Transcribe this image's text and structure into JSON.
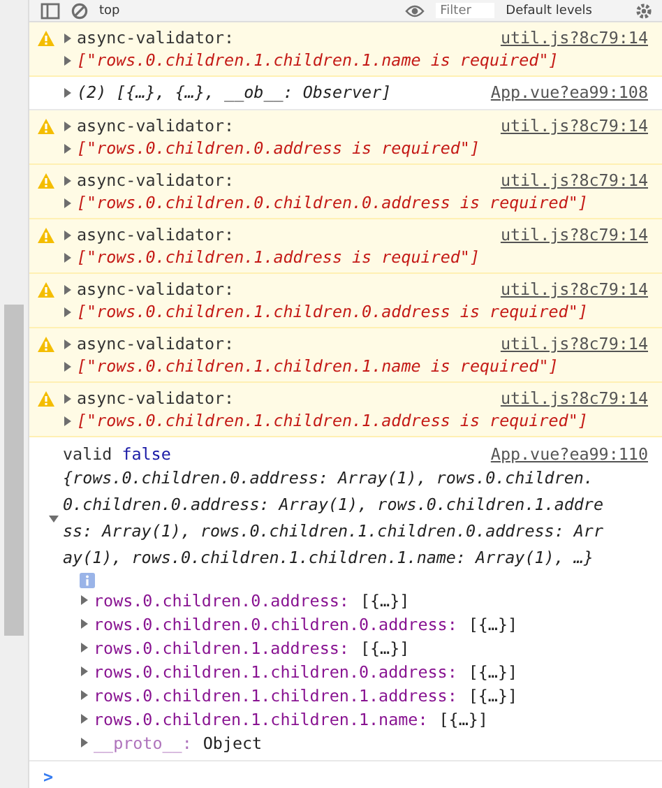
{
  "toolbar": {
    "context": "top",
    "filter_placeholder": "Filter",
    "levels": "Default levels"
  },
  "messages": [
    {
      "kind": "warning",
      "label": "async-validator:",
      "value": "[\"rows.0.children.1.children.1.name is required\"]",
      "source": "util.js?8c79:14"
    },
    {
      "kind": "log",
      "value": "(2) [{…}, {…}, __ob__: Observer]",
      "source": "App.vue?ea99:108"
    },
    {
      "kind": "warning",
      "label": "async-validator:",
      "value": "[\"rows.0.children.0.address is required\"]",
      "source": "util.js?8c79:14"
    },
    {
      "kind": "warning",
      "label": "async-validator:",
      "value": "[\"rows.0.children.0.children.0.address is required\"]",
      "source": "util.js?8c79:14"
    },
    {
      "kind": "warning",
      "label": "async-validator:",
      "value": "[\"rows.0.children.1.address is required\"]",
      "source": "util.js?8c79:14"
    },
    {
      "kind": "warning",
      "label": "async-validator:",
      "value": "[\"rows.0.children.1.children.0.address is required\"]",
      "source": "util.js?8c79:14"
    },
    {
      "kind": "warning",
      "label": "async-validator:",
      "value": "[\"rows.0.children.1.children.1.name is required\"]",
      "source": "util.js?8c79:14"
    },
    {
      "kind": "warning",
      "label": "async-validator:",
      "value": "[\"rows.0.children.1.children.1.address is required\"]",
      "source": "util.js?8c79:14"
    }
  ],
  "result": {
    "label": "valid",
    "value": "false",
    "source": "App.vue?ea99:110",
    "preview": "{rows.0.children.0.address: Array(1), rows.0.children.0.children.0.address: Array(1), rows.0.children.1.address: Array(1), rows.0.children.1.children.0.address: Array(1), rows.0.children.1.children.1.name: Array(1), …}",
    "expanded": true,
    "properties": [
      {
        "key": "rows.0.children.0.address:",
        "value": "[{…}]"
      },
      {
        "key": "rows.0.children.0.children.0.address:",
        "value": "[{…}]"
      },
      {
        "key": "rows.0.children.1.address:",
        "value": "[{…}]"
      },
      {
        "key": "rows.0.children.1.children.0.address:",
        "value": "[{…}]"
      },
      {
        "key": "rows.0.children.1.children.1.address:",
        "value": "[{…}]"
      },
      {
        "key": "rows.0.children.1.children.1.name:",
        "value": "[{…}]"
      }
    ],
    "proto": {
      "key": "__proto__:",
      "value": "Object"
    }
  },
  "prompt": ">"
}
